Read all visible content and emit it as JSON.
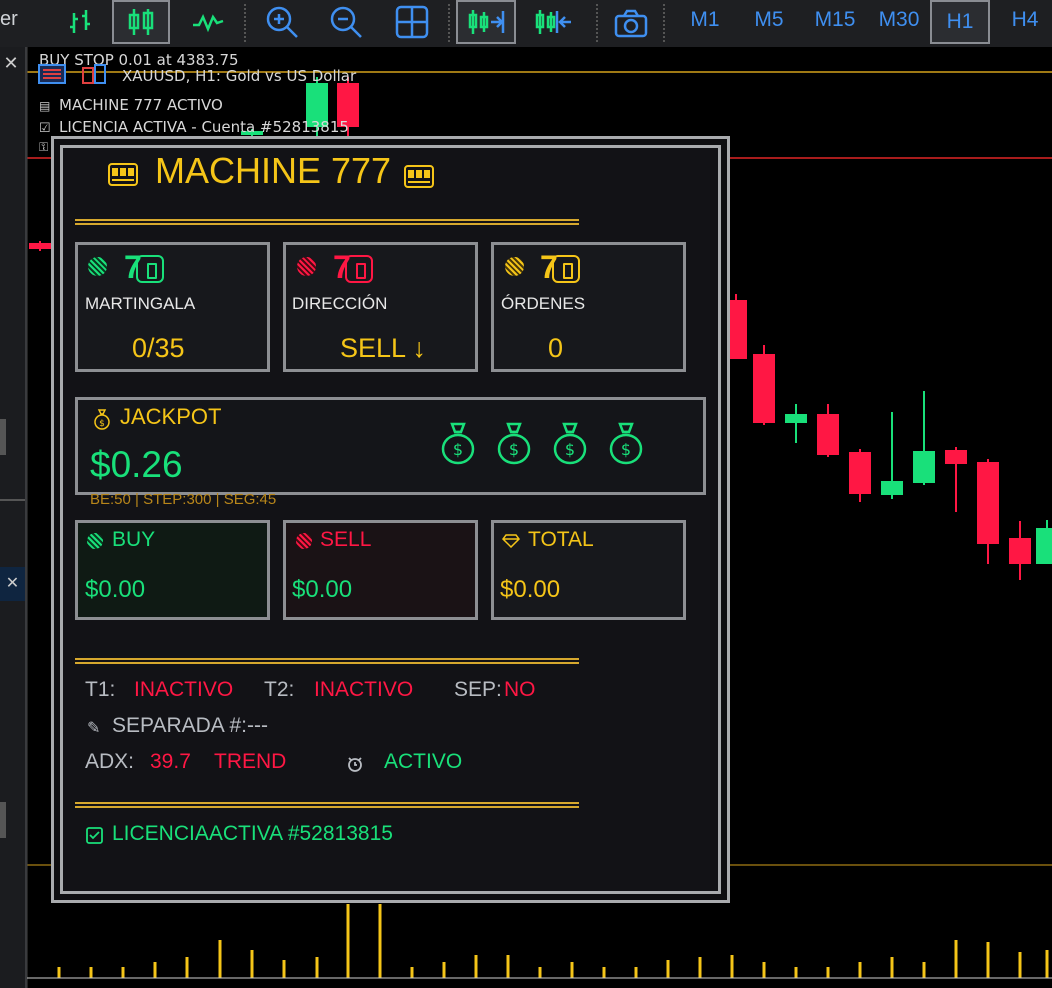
{
  "toolbar": {
    "left_text": "er",
    "timeframes": [
      "M1",
      "M5",
      "M15",
      "M30",
      "H1",
      "H4"
    ],
    "selected_timeframe": "H1",
    "accent": "#3f8ff0"
  },
  "chart": {
    "order_label": "BUY STOP 0.01 at 4383.75",
    "symbol_label": "XAUUSD, H1:  Gold vs US Dollar",
    "status_line_1": "MACHINE 777 ACTIVO",
    "status_line_2": "LICENCIA ACTIVA - Cuenta #52813815",
    "bull_color": "#19e07a",
    "bear_color": "#ff1744"
  },
  "panel": {
    "title": "MACHINE 777",
    "cards": [
      {
        "label": "MARTINGALA",
        "value": "0/35",
        "digit": "7",
        "color": "#19e07a"
      },
      {
        "label": "DIRECCIÓN",
        "value": "SELL ↓",
        "digit": "7",
        "color": "#ff1744"
      },
      {
        "label": "ÓRDENES",
        "value": "0",
        "digit": "7",
        "color": "#f5c518"
      }
    ],
    "jackpot": {
      "label": "JACKPOT",
      "value": "$0.26",
      "footer": "BE:50 | STEP:300 | SEG:45"
    },
    "totals": [
      {
        "label": "BUY",
        "value": "$0.00",
        "color": "#19e07a"
      },
      {
        "label": "SELL",
        "value": "$0.00",
        "color": "#ff1744"
      },
      {
        "label": "TOTAL",
        "value": "$0.00",
        "color": "#f5c518"
      }
    ],
    "status": {
      "t1_label": "T1:",
      "t1_value": "INACTIVO",
      "t2_label": "T2:",
      "t2_value": "INACTIVO",
      "sep_label": "SEP:",
      "sep_value": "NO",
      "separada": "SEPARADA #:---",
      "adx_label": "ADX:",
      "adx_value": "39.7",
      "adx_state": "TREND",
      "alarm_state": "ACTIVO"
    },
    "license": "LICENCIAACTIVA #52813815"
  }
}
